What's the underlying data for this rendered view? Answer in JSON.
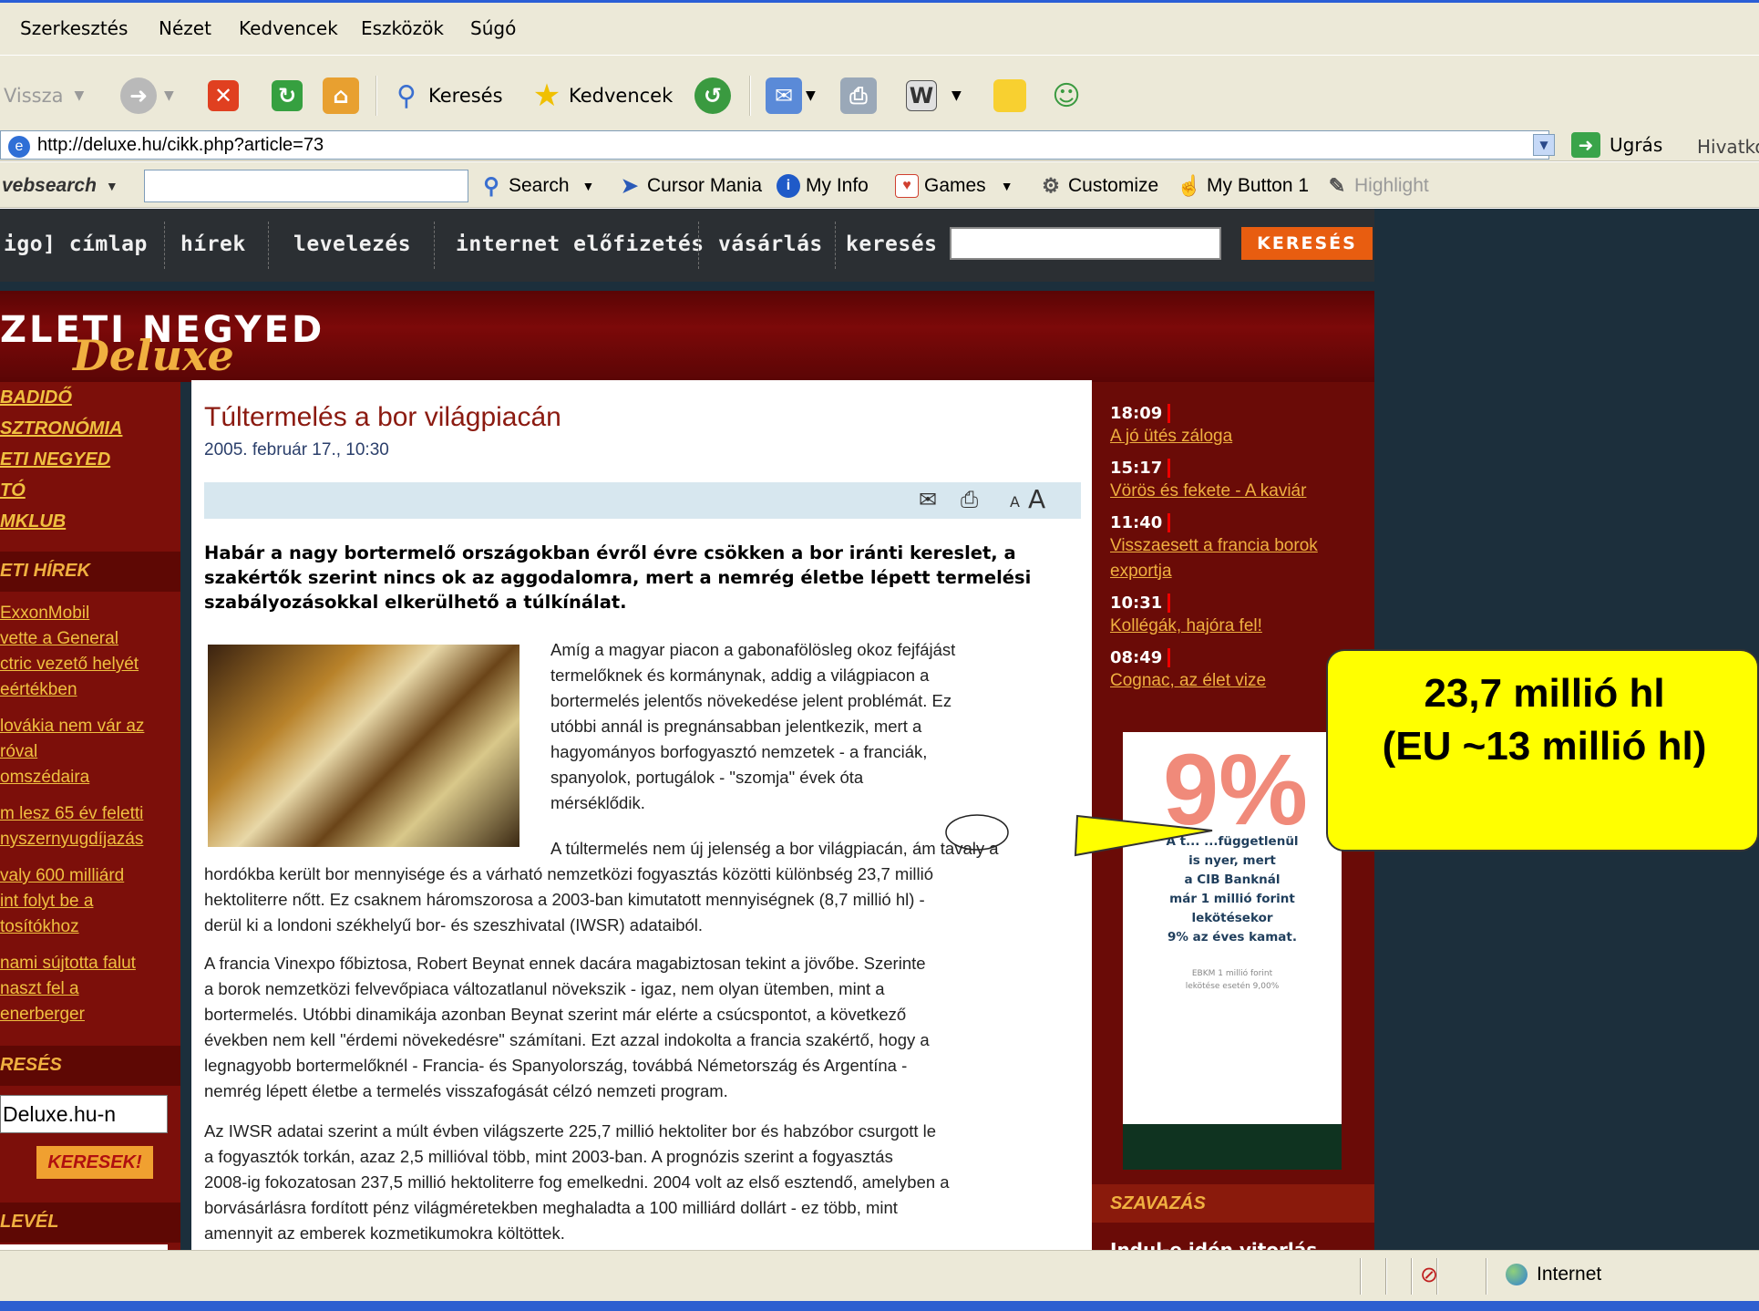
{
  "menubar": {
    "items": [
      "Szerkesztés",
      "Nézet",
      "Kedvencek",
      "Eszközök",
      "Súgó"
    ]
  },
  "toolbar": {
    "back_label": "Vissza",
    "search_label": "Keresés",
    "favorites_label": "Kedvencek"
  },
  "address": {
    "url": "http://deluxe.hu/cikk.php?article=73",
    "go_label": "Ugrás",
    "links_label": "Hivatko"
  },
  "websearch": {
    "brand": "vebsearch",
    "search_label": "Search",
    "cursor_mania": "Cursor Mania",
    "my_info": "My Info",
    "games": "Games",
    "customize": "Customize",
    "my_button": "My Button 1",
    "highlight": "Highlight"
  },
  "sitenav": {
    "items": [
      "igo] címlap",
      "hírek",
      "levelezés",
      "internet előfizetés",
      "vásárlás",
      "keresés"
    ],
    "search_button": "KERESÉS"
  },
  "banner": {
    "title": "ZLETI NEGYED",
    "subtitle": "Deluxe"
  },
  "leftcol": {
    "categories": [
      "BADIDŐ",
      "SZTRONÓMIA",
      "ETI NEGYED",
      "TÓ",
      "MKLUB"
    ],
    "news_head": "ETI HÍREK",
    "news_links": [
      "ExxonMobil",
      "vette a General",
      "ctric vezető helyét",
      "eértékben",
      "lovákia nem vár az",
      "róval",
      "omszédaira",
      "m lesz 65 év feletti",
      "nyszernyugdíjazás",
      "valy 600 milliárd",
      "int folyt be a",
      "tosítókhoz",
      "nami sújtotta falut",
      "naszt fel a",
      "enerberger"
    ],
    "search_head": "RESÉS",
    "search_value": "Deluxe.hu-n",
    "search_button": "KERESEK!",
    "mail_head": "LEVÉL"
  },
  "article": {
    "title": "Túltermelés a bor világpiacán",
    "date": "2005. február 17., 10:30",
    "font_small": "A",
    "font_large": "A",
    "lead": "Habár a nagy bortermelő országokban évről évre csökken a bor iránti kereslet, a szakértők szerint nincs ok az aggodalomra, mert a nemrég életbe lépett termelési szabályozásokkal elkerülhető a túlkínálat.",
    "p1_lines": [
      "Amíg a magyar piacon a gabonafölösleg okoz fejfájást",
      "termelőknek és kormánynak,  addig a világpiacon a",
      "bortermelés jelentős növekedése jelent  problémát. Ez",
      "utóbbi annál is pregnánsabban jelentkezik, mert a",
      "hagyományos borfogyasztó nemzetek - a franciák,",
      "spanyolok,  portugálok - \"szomja\" évek óta",
      "mérséklődik."
    ],
    "p2_first": "A túltermelés nem új jelenség a bor világpiacán, ám tavaly a",
    "p2_lines": [
      "hordókba  került bor mennyisége és a várható nemzetközi fogyasztás közötti különbség 23,7 millió",
      "hektoliterre nőtt. Ez csaknem  háromszorosa a 2003-ban kimutatott mennyiségnek (8,7 millió hl) -",
      "derül ki a londoni székhelyű bor- és szeszhivatal (IWSR) adataiból."
    ],
    "p3_lines": [
      "A francia Vinexpo főbiztosa, Robert Beynat ennek dacára  magabiztosan tekint a jövőbe. Szerinte",
      "a borok nemzetközi  felvevőpiaca változatlanul növekszik - igaz, nem olyan ütemben, mint  a",
      "bortermelés. Utóbbi dinamikája azonban Beynat szerint már elérte a  csúcspontot, a következő",
      "években nem kell \"érdemi növekedésre\" számítani. Ezt azzal indokolta a francia szakértő, hogy a",
      "legnagyobb  bortermelőknél - Francia- és Spanyolország, továbbá Németország és  Argentína -",
      "nemrég lépett életbe a termelés visszafogását célzó nemzeti program."
    ],
    "p4_lines": [
      "Az IWSR adatai szerint a múlt évben világszerte 225,7 millió  hektoliter bor és habzóbor csurgott le",
      "a fogyasztók torkán, azaz 2,5  millióval több, mint 2003-ban. A prognózis szerint a fogyasztás",
      "2008-ig fokozatosan 237,5 millió hektoliterre fog emelkedni. 2004  volt az első esztendő, amelyben a",
      "borvásárlásra fordított pénz  világméretekben meghaladta a 100 milliárd dollárt - ez több, mint",
      "amennyit az emberek kozmetikumokra költöttek."
    ]
  },
  "rightcol": {
    "news": [
      {
        "time": "18:09",
        "lines": [
          "A jó ütés záloga"
        ]
      },
      {
        "time": "15:17",
        "lines": [
          "Vörös és fekete - A kaviár"
        ]
      },
      {
        "time": "11:40",
        "lines": [
          "Visszaesett a francia borok",
          "exportja"
        ]
      },
      {
        "time": "10:31",
        "lines": [
          "Kollégák, hajóra fel!"
        ]
      },
      {
        "time": "08:49",
        "lines": [
          "Cognac, az élet vize"
        ]
      }
    ],
    "ad": {
      "percent": "9%",
      "lines": [
        "A t... ...függetlenül",
        "is nyer, mert",
        "a CIB Banknál",
        "már 1 millió forint",
        "lekötésekor",
        "9% az éves kamat."
      ],
      "small_lines": [
        "EBKM 1 millió forint",
        "lekötése esetén 9,00%"
      ]
    },
    "vote_head": "SZAVAZÁS",
    "vote_question": "Indul-e idén vitorlás"
  },
  "statusbar": {
    "zone": "Internet"
  },
  "callout": {
    "line1": "23,7 millió hl",
    "line2": "(EU ~13 millió hl)"
  },
  "colors": {
    "callout_fill": "#ffff00",
    "site_red": "#7c0f0a",
    "link_gold": "#f0c040",
    "search_orange": "#e85d10"
  }
}
